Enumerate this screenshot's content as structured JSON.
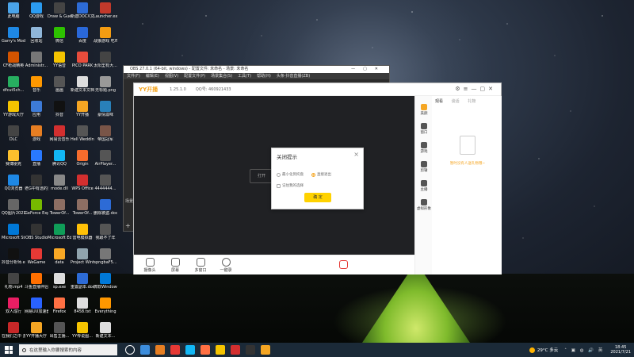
{
  "desktop_icons": [
    {
      "label": "此电脑",
      "color": "#4aa3e8"
    },
    {
      "label": "QQ游戏",
      "color": "#2b9bf0"
    },
    {
      "label": "Draw & Guess",
      "color": "#444"
    },
    {
      "label": "新建DOCX文档.docx",
      "color": "#2d6bd6"
    },
    {
      "label": "Launcher.exe",
      "color": "#c0392b"
    },
    {
      "label": "Garry's Mod",
      "color": "#1e88e5"
    },
    {
      "label": "回收站",
      "color": "#8fb6d9"
    },
    {
      "label": "微信",
      "color": "#2dc100"
    },
    {
      "label": "百度",
      "color": "#2a68d8"
    },
    {
      "label": "战狼游戏 吃鸡",
      "color": "#f39c12"
    },
    {
      "label": "CF枪战精英",
      "color": "#d35400"
    },
    {
      "label": "Administr...",
      "color": "#777"
    },
    {
      "label": "YY语音",
      "color": "#f5c400"
    },
    {
      "label": "PICO PARK",
      "color": "#e74c3c"
    },
    {
      "label": "太阳里有大...",
      "color": "#444"
    },
    {
      "label": "dfcut5ch...",
      "color": "#27ae60"
    },
    {
      "label": "音乐",
      "color": "#ff9800"
    },
    {
      "label": "画画",
      "color": "#555"
    },
    {
      "label": "新建文本文档.txt",
      "color": "#ddd"
    },
    {
      "label": "无标题.png",
      "color": "#999"
    },
    {
      "label": "YY游戏大厅",
      "color": "#f5c400"
    },
    {
      "label": "应用",
      "color": "#3d7bd8"
    },
    {
      "label": "抖音",
      "color": "#111"
    },
    {
      "label": "YY开播",
      "color": "#f5a623"
    },
    {
      "label": "豪情滋味",
      "color": "#2980b9"
    },
    {
      "label": "DLC",
      "color": "#444"
    },
    {
      "label": "游戏",
      "color": "#e67e22"
    },
    {
      "label": "网易云音乐",
      "color": "#d32f2f"
    },
    {
      "label": "Hell Wedding...",
      "color": "#555"
    },
    {
      "label": "帝国冠军",
      "color": "#795548"
    },
    {
      "label": "赛博朋克",
      "color": "#fbc02d"
    },
    {
      "label": "直播",
      "color": "#2979ff"
    },
    {
      "label": "腾讯QQ",
      "color": "#12b7f5"
    },
    {
      "label": "Origin",
      "color": "#f56c2d"
    },
    {
      "label": "AirPlayer...",
      "color": "#555"
    },
    {
      "label": "QQ浏览器",
      "color": "#1e88e5"
    },
    {
      "label": "老G中有透的显.mov",
      "color": "#333"
    },
    {
      "label": "mode.dll",
      "color": "#888"
    },
    {
      "label": "WPS Office",
      "color": "#d32f2f"
    },
    {
      "label": "4444444...",
      "color": "#555"
    },
    {
      "label": "QQ图片2021021...",
      "color": "#666"
    },
    {
      "label": "GeForce Experience",
      "color": "#76b900"
    },
    {
      "label": "TowerOf...",
      "color": "#8d6e63"
    },
    {
      "label": "TowerOf...",
      "color": "#8d6e63"
    },
    {
      "label": "删除被盗.doc",
      "color": "#2d6bd6"
    },
    {
      "label": "Microsoft Store",
      "color": "#0078d7"
    },
    {
      "label": "OBS Studio",
      "color": "#333"
    },
    {
      "label": "Microsoft Edge",
      "color": "#0f9d58"
    },
    {
      "label": "雷电模拟器",
      "color": "#ffc107"
    },
    {
      "label": "我跟不了年",
      "color": "#555"
    },
    {
      "label": "抖音分析师.exe",
      "color": "#111"
    },
    {
      "label": "WeGame",
      "color": "#e53935"
    },
    {
      "label": "data",
      "color": "#f9a825"
    },
    {
      "label": "Project Winter",
      "color": "#90a4ae"
    },
    {
      "label": "spngbaF5...",
      "color": "#777"
    },
    {
      "label": "礼物.mp4",
      "color": "#444"
    },
    {
      "label": "斗鱼直播伴侣",
      "color": "#ff6f00"
    },
    {
      "label": "sp.exe",
      "color": "#ddd"
    },
    {
      "label": "重置副本.doc",
      "color": "#2d6bd6"
    },
    {
      "label": "微软Windows...",
      "color": "#0078d7"
    },
    {
      "label": "双人成行",
      "color": "#e91e63"
    },
    {
      "label": "网易UU加速器",
      "color": "#2962ff"
    },
    {
      "label": "Firefox",
      "color": "#ff7043"
    },
    {
      "label": "8458.txt",
      "color": "#ddd"
    },
    {
      "label": "Everything",
      "color": "#ff9800"
    },
    {
      "label": "在我们之中 游戏",
      "color": "#c62828"
    },
    {
      "label": "YY开播大厅",
      "color": "#f5a623"
    },
    {
      "label": "出售主播...",
      "color": "#555"
    },
    {
      "label": "YY传说图...",
      "color": "#f5c400"
    },
    {
      "label": "新建文本...",
      "color": "#ddd"
    },
    {
      "label": "主播数据...",
      "color": "#555"
    }
  ],
  "obs": {
    "title": "OBS 27.0.1 (64-bit, windows) - 配置文件: 未命名 - 场景: 未命名",
    "menu": [
      "文件(F)",
      "编辑(E)",
      "视图(V)",
      "配置文件(P)",
      "场景集合(S)",
      "工具(T)",
      "帮助(H)",
      "头条·抖音直播(ZB)"
    ],
    "scene_label": "场景",
    "add": "+"
  },
  "yy": {
    "logo": "YY开播",
    "version": "1.25.1.0",
    "qq": "QQ号: 460921433",
    "preview_button": "打开",
    "tools": [
      "摄像头",
      "屏幕",
      "多窗口",
      "一键录"
    ],
    "rightbar": [
      "美颜",
      "窗口",
      "游戏",
      "剪辑",
      "主播",
      "虚拟形象"
    ],
    "tabs": [
      "观看",
      "谈话",
      "礼物"
    ],
    "empty_text": "暂时没有人送礼物哦~"
  },
  "modal": {
    "title": "关闭提示",
    "opt1": "最小化到托盘",
    "opt2": "直接退出",
    "remember": "记住我的选择",
    "ok": "确 定"
  },
  "taskbar": {
    "search_placeholder": "在这里输入你要搜索的内容",
    "weather": "29°C 多云",
    "time": "18:45",
    "date": "2021/7/21"
  },
  "colors": {
    "accent": "#f5a623",
    "ok": "#ffd200",
    "taskbar": "#1b2a38"
  }
}
